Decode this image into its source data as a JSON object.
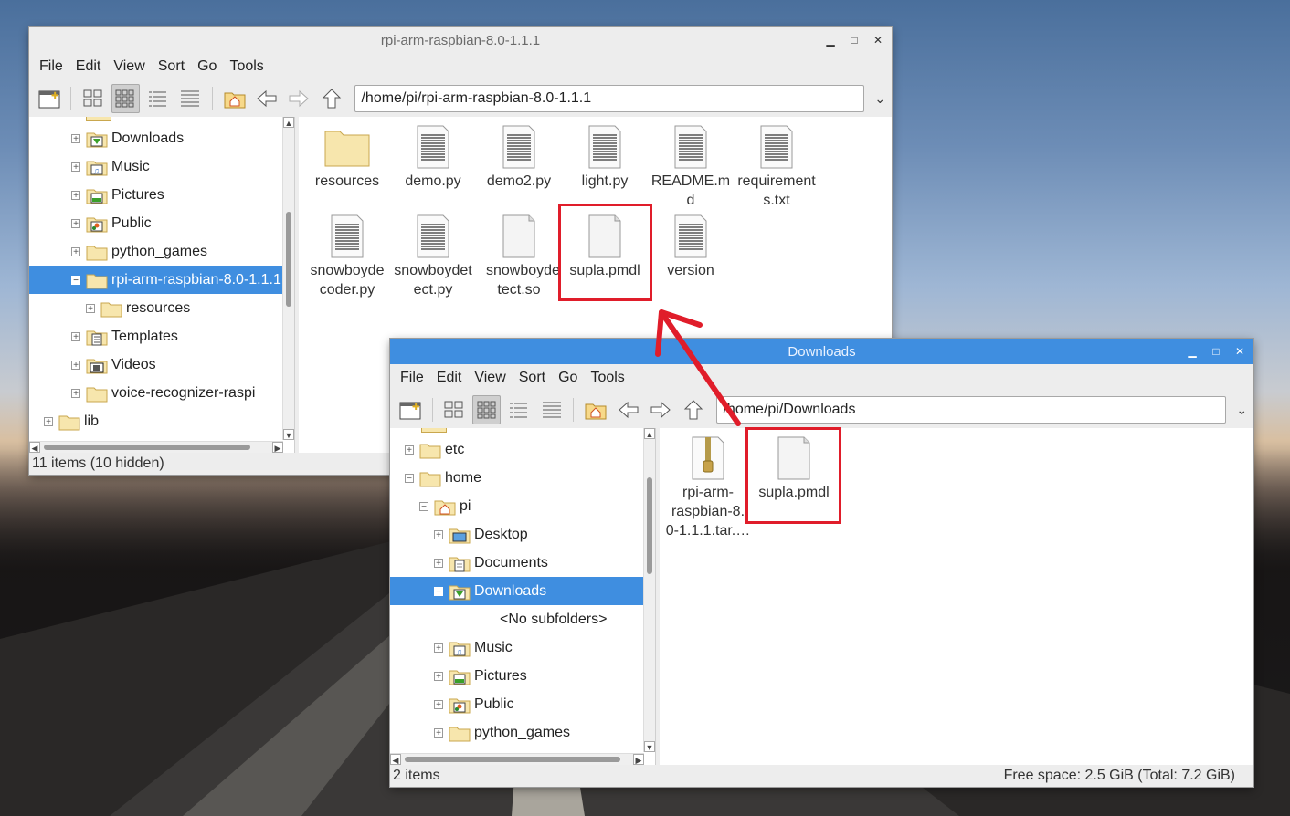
{
  "colors": {
    "accent": "#3f8ee0",
    "highlight": "#e01d2a",
    "arrow": "#e01d2a"
  },
  "window1": {
    "title": "rpi-arm-raspbian-8.0-1.1.1",
    "menu": [
      "File",
      "Edit",
      "View",
      "Sort",
      "Go",
      "Tools"
    ],
    "path": "/home/pi/rpi-arm-raspbian-8.0-1.1.1",
    "tree": [
      {
        "label": "Downloads",
        "icon": "downloads-folder-icon"
      },
      {
        "label": "Music",
        "icon": "music-folder-icon"
      },
      {
        "label": "Pictures",
        "icon": "pictures-folder-icon"
      },
      {
        "label": "Public",
        "icon": "public-folder-icon"
      },
      {
        "label": "python_games",
        "icon": "folder-icon"
      },
      {
        "label": "rpi-arm-raspbian-8.0-1.1.1",
        "icon": "folder-icon"
      },
      {
        "label": "resources",
        "icon": "folder-icon"
      },
      {
        "label": "Templates",
        "icon": "templates-folder-icon"
      },
      {
        "label": "Videos",
        "icon": "videos-folder-icon"
      },
      {
        "label": "voice-recognizer-raspi",
        "icon": "folder-icon"
      },
      {
        "label": "lib",
        "icon": "folder-icon"
      }
    ],
    "files": [
      {
        "name": "resources",
        "line1": "resources",
        "line2": "",
        "type": "folder"
      },
      {
        "name": "demo.py",
        "line1": "demo.py",
        "line2": "",
        "type": "text"
      },
      {
        "name": "demo2.py",
        "line1": "demo2.py",
        "line2": "",
        "type": "text"
      },
      {
        "name": "light.py",
        "line1": "light.py",
        "line2": "",
        "type": "text"
      },
      {
        "name": "README.md",
        "line1": "README.m",
        "line2": "d",
        "type": "text"
      },
      {
        "name": "requirements.txt",
        "line1": "requirement",
        "line2": "s.txt",
        "type": "text"
      },
      {
        "name": "snowboydecoder.py",
        "line1": "snowboyde",
        "line2": "coder.py",
        "type": "text"
      },
      {
        "name": "snowboydetect.py",
        "line1": "snowboydet",
        "line2": "ect.py",
        "type": "text"
      },
      {
        "name": "_snowboydetect.so",
        "line1": "_snowboyde",
        "line2": "tect.so",
        "type": "blank"
      },
      {
        "name": "supla.pmdl",
        "line1": "supla.pmdl",
        "line2": "",
        "type": "blank"
      },
      {
        "name": "version",
        "line1": "version",
        "line2": "",
        "type": "text"
      }
    ],
    "status": "11 items (10 hidden)"
  },
  "window2": {
    "title": "Downloads",
    "menu": [
      "File",
      "Edit",
      "View",
      "Sort",
      "Go",
      "Tools"
    ],
    "path": "/home/pi/Downloads",
    "tree": [
      {
        "label": "etc",
        "icon": "folder-icon"
      },
      {
        "label": "home",
        "icon": "folder-icon"
      },
      {
        "label": "pi",
        "icon": "home-folder-icon"
      },
      {
        "label": "Desktop",
        "icon": "desktop-folder-icon"
      },
      {
        "label": "Documents",
        "icon": "documents-folder-icon"
      },
      {
        "label": "Downloads",
        "icon": "downloads-folder-icon"
      },
      {
        "label": "<No subfolders>",
        "icon": ""
      },
      {
        "label": "Music",
        "icon": "music-folder-icon"
      },
      {
        "label": "Pictures",
        "icon": "pictures-folder-icon"
      },
      {
        "label": "Public",
        "icon": "public-folder-icon"
      },
      {
        "label": "python_games",
        "icon": "folder-icon"
      }
    ],
    "files": [
      {
        "name": "rpi-arm-raspbian-8.0-1.1.1.tar",
        "line1": "rpi-arm-",
        "line2": "raspbian-8.",
        "line3": "0-1.1.1.tar.…",
        "type": "archive"
      },
      {
        "name": "supla.pmdl",
        "line1": "supla.pmdl",
        "line2": "",
        "line3": "",
        "type": "blank"
      }
    ],
    "status_left": "2 items",
    "status_right": "Free space: 2.5 GiB (Total: 7.2 GiB)"
  }
}
